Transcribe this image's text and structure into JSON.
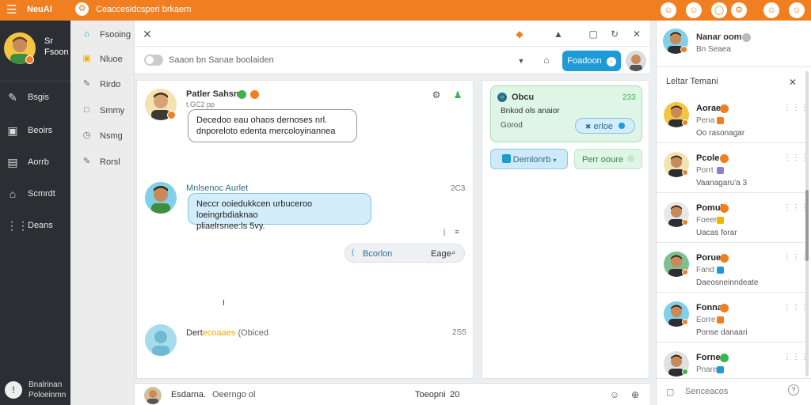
{
  "topbar": {
    "app_title": "NeuAI",
    "subtitle": "Ceaccesidcsperi brkaem"
  },
  "profile": {
    "name_line1": "Sr",
    "name_line2": "Fsoon"
  },
  "nav": {
    "items": [
      {
        "label": "Bsgis",
        "icon": "pin-icon"
      },
      {
        "label": "Beoirs",
        "icon": "window-icon"
      },
      {
        "label": "Aorrb",
        "icon": "notification-icon"
      },
      {
        "label": "Scmrdt",
        "icon": "home-icon"
      },
      {
        "label": "Deans",
        "icon": "grid-icon"
      }
    ],
    "bottom_label_line1": "Bnalrinan",
    "bottom_label_line2": "Poloeinmn"
  },
  "subnav": {
    "items": [
      {
        "label": "Fsooing"
      },
      {
        "label": "Nluoe"
      },
      {
        "label": "Rirdo"
      },
      {
        "label": "Smmy"
      },
      {
        "label": "Nsmg"
      },
      {
        "label": "Rorsl"
      }
    ]
  },
  "toolbar": {
    "search_placeholder": "Saaon bn Sanae boolaiden",
    "primary_button": "Foadoon"
  },
  "chat": {
    "msg1_sender": "Patler Sahsn",
    "msg1_time": "t.GC2 pp",
    "msg1_text_line1": "Decedoo eau ohaos dernoses nrl.",
    "msg1_text_line2": "dnporeloto edenta mercoloyinannea",
    "msg2_sender": "Mnlsenoc Aurlet",
    "msg2_time": "2C3",
    "msg2_text_line1": "Neccr ooiedukkcen urbuceroo loeingrbdiaknao",
    "msg2_text_line2": "pliaelrsnee:ls 5vy.",
    "reply_left": "Bcorlon",
    "reply_right": "Eage",
    "msg3_sender_a": "Dert",
    "msg3_sender_b": "ecoaaes",
    "msg3_sender_c": "(Obiced",
    "msg3_time": "2S5"
  },
  "rightpanel": {
    "card_title": "Obcu",
    "card_count": "233",
    "card_line": "Bnkod ols anaior",
    "card_small": "Gorod",
    "card_button": "erloe",
    "btn_a": "Demlonrb",
    "btn_b": "Perr ooure"
  },
  "inputbar": {
    "sender": "Esdarna.",
    "text": "Oeerngo ol",
    "mid_text": "Toeopni",
    "count": "20"
  },
  "contacts": {
    "me_name": "Nanar oom",
    "me_status": "Bn Seaea",
    "section_title": "Leltar Temani",
    "items": [
      {
        "name": "Aorae",
        "status": "Pena",
        "msg": "Oo rasonagar"
      },
      {
        "name": "Pcole",
        "status": "Porrt",
        "msg": "Vaanagaru'a 3"
      },
      {
        "name": "Pomuk",
        "status": "Foeer",
        "msg": "Uacas forar"
      },
      {
        "name": "Porue",
        "status": "Fand",
        "msg": "Daeosneinndeate"
      },
      {
        "name": "Fonna",
        "status": "Eorre",
        "msg": "Ponse danaari"
      },
      {
        "name": "Forne",
        "status": "Pnare",
        "msg": ""
      }
    ],
    "search_placeholder": "Senceacos"
  },
  "colors": {
    "accent": "#f07f22",
    "nav_bg": "#2b2f33",
    "primary_button": "#1e9ad6",
    "bubble_blue": "#d3edfa",
    "card_green": "#dff5e6"
  }
}
